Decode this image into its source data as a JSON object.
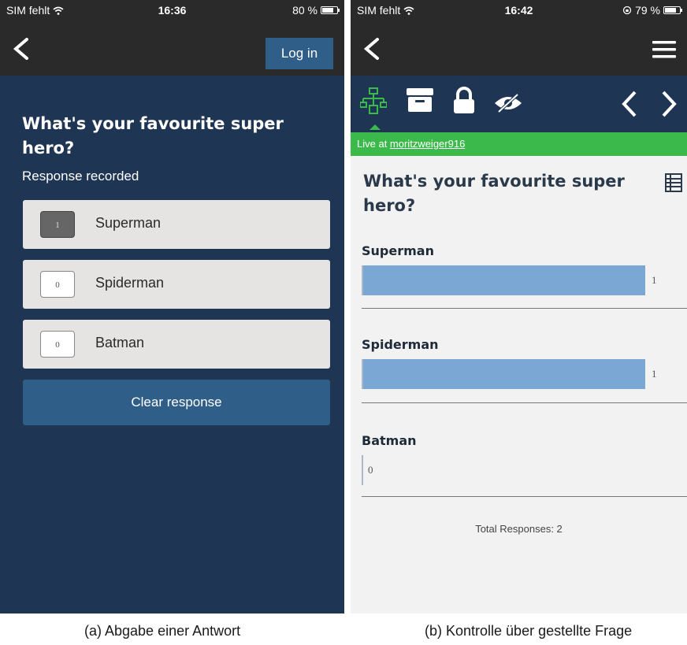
{
  "left_screen": {
    "status": {
      "carrier": "SIM fehlt",
      "time": "16:36",
      "battery": "80 %",
      "battery_level": 0.8
    },
    "nav": {
      "login_label": "Log in"
    },
    "question": "What's your favourite super hero?",
    "status_text": "Response recorded",
    "options": [
      {
        "label": "Superman",
        "count": "1",
        "selected": true
      },
      {
        "label": "Spiderman",
        "count": "0",
        "selected": false
      },
      {
        "label": "Batman",
        "count": "0",
        "selected": false
      }
    ],
    "clear_label": "Clear response",
    "caption": "(a) Abgabe einer Antwort"
  },
  "right_screen": {
    "status": {
      "carrier": "SIM fehlt",
      "time": "16:42",
      "battery": "79 %",
      "battery_level": 0.79
    },
    "toolbar_icons": [
      "network-icon",
      "archive-icon",
      "lock-icon",
      "hidden-eye-icon",
      "chevron-left-icon",
      "chevron-right-icon"
    ],
    "live": {
      "prefix": "Live at ",
      "user": "moritzweiger916"
    },
    "question": "What's your favourite super hero?",
    "results": [
      {
        "label": "Superman",
        "value": "1",
        "count": 1
      },
      {
        "label": "Spiderman",
        "value": "1",
        "count": 1
      },
      {
        "label": "Batman",
        "value": "0",
        "count": 0
      }
    ],
    "total": "Total Responses: 2",
    "caption": "(b) Kontrolle über gestellte Frage"
  },
  "colors": {
    "dark_navy": "#1e3553",
    "button_blue": "#2f5e88",
    "live_green": "#3cb94b",
    "bar_blue": "#7aa7d3"
  }
}
